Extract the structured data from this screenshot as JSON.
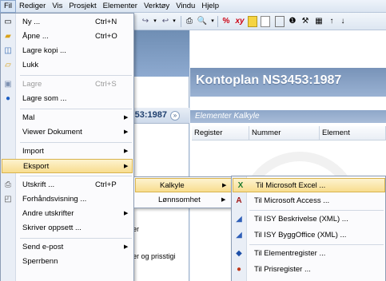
{
  "menubar": [
    "Fil",
    "Rediger",
    "Vis",
    "Prosjekt",
    "Elementer",
    "Verktøy",
    "Vindu",
    "Hjelp"
  ],
  "toolbar": {
    "percent_icon": "%",
    "xy_icon": "xy"
  },
  "left_panel": {
    "kontoplan_label": "53:1987",
    "bg_texts": [
      "er",
      "er og prisstigi"
    ]
  },
  "right_panel": {
    "title": "Kontoplan NS3453:1987",
    "subtitle": "Elementer Kalkyle",
    "columns": [
      "Register",
      "Nummer",
      "Element"
    ]
  },
  "file_menu": [
    {
      "label": "Ny ...",
      "shortcut": "Ctrl+N",
      "icon": "new-file-icon"
    },
    {
      "label": "Åpne ...",
      "shortcut": "Ctrl+O",
      "icon": "open-folder-icon"
    },
    {
      "label": "Lagre kopi ...",
      "shortcut": "",
      "icon": "save-copy-icon"
    },
    {
      "label": "Lukk",
      "shortcut": "",
      "icon": "close-folder-icon"
    },
    {
      "label": "Lagre",
      "shortcut": "Ctrl+S",
      "icon": "save-icon",
      "disabled": true
    },
    {
      "label": "Lagre som ...",
      "shortcut": "",
      "icon": "save-as-icon"
    },
    {
      "label": "Mal",
      "arrow": true
    },
    {
      "label": "Viewer Dokument",
      "arrow": true
    },
    {
      "label": "Import",
      "arrow": true
    },
    {
      "label": "Eksport",
      "arrow": true,
      "highlight": true
    },
    {
      "label": "Utskrift ...",
      "shortcut": "Ctrl+P",
      "icon": "print-icon"
    },
    {
      "label": "Forhåndsvisning ...",
      "icon": "preview-icon"
    },
    {
      "label": "Andre utskrifter",
      "arrow": true
    },
    {
      "label": "Skriver oppsett ..."
    },
    {
      "label": "Send e-post",
      "arrow": true
    },
    {
      "label": "Sperrbenn"
    }
  ],
  "export_menu": [
    {
      "label": "Kalkyle",
      "arrow": true,
      "highlight": true
    },
    {
      "label": "Lønnsomhet",
      "arrow": true
    }
  ],
  "kalkyle_menu": [
    {
      "label": "Til Microsoft Excel ...",
      "icon": "excel-icon",
      "highlight": true
    },
    {
      "label": "Til Microsoft Access ...",
      "icon": "access-icon"
    },
    {
      "label": "Til ISY Beskrivelse (XML) ...",
      "icon": "isy-beskrivelse-icon"
    },
    {
      "label": "Til ISY ByggOffice (XML) ...",
      "icon": "isy-byggoffice-icon"
    },
    {
      "label": "Til Elementregister ...",
      "icon": "elementregister-icon"
    },
    {
      "label": "Til Prisregister ...",
      "icon": "prisregister-icon"
    }
  ]
}
